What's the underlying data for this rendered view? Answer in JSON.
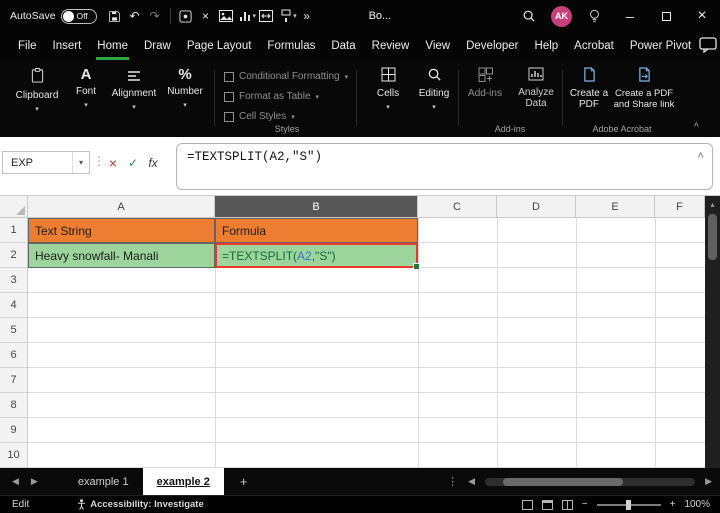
{
  "titlebar": {
    "autosave_label": "AutoSave",
    "autosave_state": "Off",
    "doc_name": "Bo...",
    "avatar_initials": "AK"
  },
  "menubar": {
    "tabs": [
      "File",
      "Insert",
      "Home",
      "Draw",
      "Page Layout",
      "Formulas",
      "Data",
      "Review",
      "View",
      "Developer",
      "Help",
      "Acrobat",
      "Power Pivot"
    ],
    "active_tab": "Home"
  },
  "ribbon": {
    "clipboard": "Clipboard",
    "font": "Font",
    "alignment": "Alignment",
    "number": "Number",
    "conditional_formatting": "Conditional Formatting",
    "format_as_table": "Format as Table",
    "cell_styles": "Cell Styles",
    "styles_group": "Styles",
    "cells": "Cells",
    "editing": "Editing",
    "addins": "Add-ins",
    "analyze_data": "Analyze Data",
    "addins_group": "Add-ins",
    "create_pdf": "Create a PDF",
    "create_pdf_share": "Create a PDF and Share link",
    "adobe_group": "Adobe Acrobat"
  },
  "formula_bar": {
    "name_box": "EXP",
    "fx_label": "fx",
    "formula": "=TEXTSPLIT(A2,\"S\")"
  },
  "grid": {
    "col_headers": [
      "A",
      "B",
      "C",
      "D",
      "E",
      "F"
    ],
    "row_headers": [
      "1",
      "2",
      "3",
      "4",
      "5",
      "6",
      "7",
      "8",
      "9",
      "10"
    ],
    "cells": {
      "a1": "Text String",
      "b1": "Formula",
      "a2": "Heavy snowfall- Manali"
    },
    "b2": {
      "pre": "=TEXTSPLIT(",
      "ref": "A2",
      "post": ",\"S\")"
    }
  },
  "sheet_bar": {
    "tabs": [
      "example 1",
      "example 2"
    ],
    "active_tab": "example 2"
  },
  "status_bar": {
    "mode": "Edit",
    "accessibility": "Accessibility: Investigate",
    "zoom": "100%"
  },
  "icons": {
    "chevron_down": "▾",
    "chevron_up": "^",
    "arrow_left": "◀",
    "arrow_right": "▶",
    "dots_vertical": "⋮",
    "check": "✓",
    "cancel": "×",
    "close": "×",
    "minimize": "–",
    "overflow": "»",
    "plus": "+",
    "minus": "−",
    "undo": "↶",
    "redo": "↷",
    "font_glyph": "A",
    "percent": "%"
  },
  "colors": {
    "header_fill_orange": "#ED7D31",
    "row_fill_green": "#9CD49B",
    "annotation_red": "#E8392E",
    "ref_blue": "#3B6FD4",
    "formula_green": "#0E6F3C",
    "accent_green": "#2BA84A",
    "avatar_pink": "#C7407B"
  }
}
